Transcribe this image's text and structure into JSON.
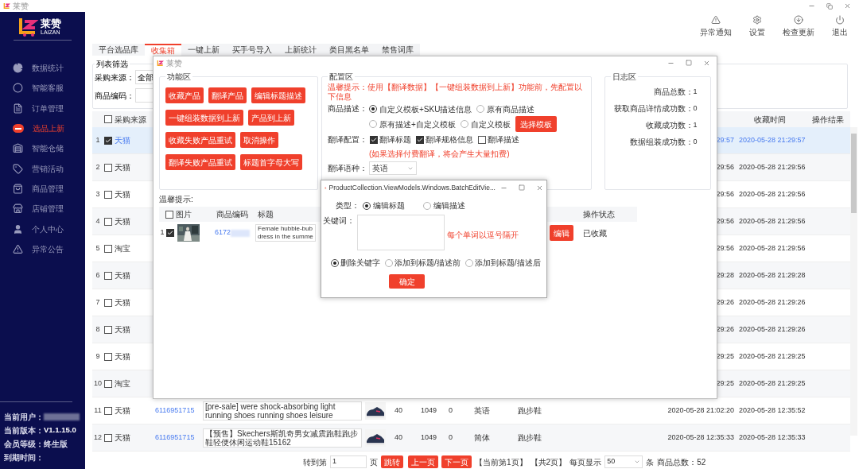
{
  "app_title": "莱赞",
  "brand": {
    "name": "莱赞",
    "subtitle": "LAIZAN"
  },
  "sidebar": {
    "items": [
      {
        "label": "数据统计",
        "selected": false
      },
      {
        "label": "智能客服",
        "selected": false
      },
      {
        "label": "订单管理",
        "selected": false
      },
      {
        "label": "选品上新",
        "selected": true
      },
      {
        "label": "智能仓储",
        "selected": false
      },
      {
        "label": "营销活动",
        "selected": false
      },
      {
        "label": "商品管理",
        "selected": false
      },
      {
        "label": "店铺管理",
        "selected": false
      },
      {
        "label": "个人中心",
        "selected": false
      },
      {
        "label": "异常公告",
        "selected": false
      }
    ],
    "footer": [
      {
        "label": "当前用户：",
        "redacted": true
      },
      {
        "label": "当前版本：",
        "value": "V1.1.15.0"
      },
      {
        "label": "会员等级：",
        "value": "终生版"
      },
      {
        "label": "到期时间："
      }
    ]
  },
  "toolbar": [
    {
      "label": "异常通知"
    },
    {
      "label": "设置"
    },
    {
      "label": "检查更新"
    },
    {
      "label": "退出"
    }
  ],
  "tabs": [
    {
      "label": "平台选品库",
      "selected": false
    },
    {
      "label": "收集箱",
      "selected": true
    },
    {
      "label": "一键上新",
      "selected": false
    },
    {
      "label": "买手号导入",
      "selected": false
    },
    {
      "label": "上新统计",
      "selected": false
    },
    {
      "label": "类目黑名单",
      "selected": false
    },
    {
      "label": "禁售词库",
      "selected": false
    }
  ],
  "filter": {
    "title": "列表筛选",
    "fields": [
      {
        "label": "采购来源：",
        "value": "全部"
      },
      {
        "label": "商品编码："
      }
    ]
  },
  "table": {
    "header_checked": false,
    "columns": {
      "source": "采购来源",
      "time_2": "收藏时间",
      "result": "操作结果"
    },
    "rows": [
      {
        "index": "1",
        "checked": true,
        "selected": true,
        "source": "天猫",
        "time_1": "29:57",
        "time_2": "2020-05-28 21:29:57"
      },
      {
        "index": "2",
        "checked": false,
        "selected": false,
        "source": "天猫",
        "time_1": "29:56",
        "time_2": "2020-05-28 21:29:56"
      },
      {
        "index": "3",
        "checked": false,
        "selected": false,
        "source": "天猫",
        "time_1": "29:56",
        "time_2": "2020-05-28 21:29:56"
      },
      {
        "index": "4",
        "checked": false,
        "selected": false,
        "source": "天猫",
        "time_1": "29:56",
        "time_2": "2020-05-28 21:29:56"
      },
      {
        "index": "5",
        "checked": false,
        "selected": false,
        "source": "淘宝",
        "time_1": "29:56",
        "time_2": "2020-05-28 21:29:56"
      },
      {
        "index": "6",
        "checked": false,
        "selected": false,
        "source": "天猫",
        "time_1": "29:28",
        "time_2": "2020-05-28 21:29:28"
      },
      {
        "index": "7",
        "checked": false,
        "selected": false,
        "source": "天猫",
        "time_1": "29:26",
        "time_2": "2020-05-28 21:29:26"
      },
      {
        "index": "8",
        "checked": false,
        "selected": false,
        "source": "天猫",
        "time_1": "29:26",
        "time_2": "2020-05-28 21:29:26"
      },
      {
        "index": "9",
        "checked": false,
        "selected": false,
        "source": "天猫",
        "time_1": "29:25",
        "time_2": "2020-05-28 21:29:25"
      },
      {
        "index": "10",
        "checked": false,
        "selected": false,
        "source": "淘宝",
        "time_1": "29:25",
        "time_2": "2020-05-28 21:29:25"
      },
      {
        "index": "11",
        "checked": false,
        "selected": false,
        "source": "天猫",
        "code": "6116951715",
        "title": "[pre-sale] were shock-absorbing light running shoes running shoes leisure",
        "image": true,
        "size": "40",
        "price": "1049",
        "count": "0",
        "language": "英语",
        "category": "跑步鞋",
        "time_1": "2020-05-28 21:02:20",
        "time_2": "2020-05-28 12:35:52"
      },
      {
        "index": "12",
        "checked": false,
        "selected": false,
        "source": "天猫",
        "code": "6116951715",
        "title": "【预售】Skechers斯凯奇男女减震跑鞋跑步鞋轻便休闲运动鞋15162",
        "image": true,
        "size": "40",
        "price": "1049",
        "count": "0",
        "language": "简体",
        "category": "跑步鞋",
        "time_1": "2020-05-28 12:35:33",
        "time_2": "2020-05-28 12:35:33"
      }
    ]
  },
  "pagination": {
    "goto_label": "转到第",
    "page_value": "1",
    "page_unit": "页",
    "jump": "跳转",
    "prev": "上一页",
    "next": "下一页",
    "current": "【当前第1页】",
    "total_pages": "【共2页】",
    "per_page_label": "每页显示",
    "per_page": "50",
    "per_page_unit": "条",
    "total": "商品总数：52"
  },
  "collect_window": {
    "title": "莱赞",
    "function_area": {
      "title": "功能区",
      "buttons": [
        "收藏产品",
        "翻译产品",
        "编辑标题描述",
        "一键组装数据到上新",
        "产品到上新",
        "收藏失败产品重试",
        "取消操作",
        "翻译失败产品重试",
        "标题首字母大写"
      ]
    },
    "config_area": {
      "title": "配置区",
      "notice": "温馨提示：使用【翻译数据】【一键组装数据到上新】功能前，先配置以下信息",
      "description_label": "商品描述：",
      "description_options": [
        {
          "label": "自定义模板+SKU描述信息",
          "selected": true
        },
        {
          "label": "原有商品描述",
          "selected": false
        },
        {
          "label": "原有描述+自定义模板",
          "selected": false
        },
        {
          "label": "自定义模板",
          "selected": false
        }
      ],
      "template_button": "选择模板",
      "translate_label": "翻译配置：",
      "translate_options": [
        {
          "label": "翻译标题",
          "checked": true
        },
        {
          "label": "翻译规格信息",
          "checked": true
        },
        {
          "label": "翻译描述",
          "checked": false
        }
      ],
      "translate_note": "(如果选择付费翻译，将会产生大量扣费)",
      "language_label": "翻译语种：",
      "language": "英语"
    },
    "log_area": {
      "title": "日志区",
      "lines": [
        {
          "label": "商品总数：",
          "value": "1"
        },
        {
          "label": "获取商品详情成功数：",
          "value": "0"
        },
        {
          "label": "收藏成功数：",
          "value": "1"
        },
        {
          "label": "数据组装成功数：",
          "value": "0"
        }
      ]
    },
    "tip_label": "温馨提示:",
    "table": {
      "header_checked": false,
      "columns": {
        "image": "图片",
        "code": "商品编码",
        "title": "标题",
        "status": "操作状态"
      },
      "rows": [
        {
          "index": "1",
          "checked": true,
          "code": "6172",
          "title_lines": [
            "Female hubble-bub",
            "dress in the summe"
          ],
          "edit_button": "编辑",
          "status": "已收藏"
        }
      ]
    }
  },
  "batch_edit_window": {
    "title": "ProductCollection.ViewModels.Windows.BatchEditVie...",
    "type_label": "类型：",
    "types": [
      {
        "label": "编辑标题",
        "selected": true
      },
      {
        "label": "编辑描述",
        "selected": false
      }
    ],
    "keyword_label": "关键词：",
    "keyword_hint": "每个单词以逗号隔开",
    "actions": [
      {
        "label": "删除关键字",
        "selected": true
      },
      {
        "label": "添加到标题/描述前",
        "selected": false
      },
      {
        "label": "添加到标题/描述后",
        "selected": false
      }
    ],
    "confirm": "确定"
  }
}
